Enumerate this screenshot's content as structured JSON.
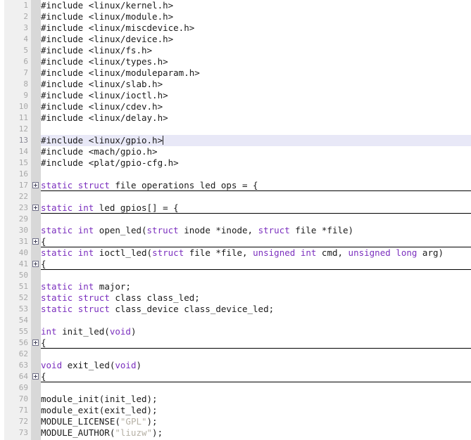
{
  "editor": {
    "type": "source-code-editor",
    "language": "C",
    "gutter_bg": "#f0f0f0",
    "fold_margin_bg": "#d8d8d8",
    "current_line_bg": "#e8e8f7",
    "keyword_color": "#7b2fbe",
    "string_color": "#b5b0a4",
    "text_color": "#1a1a1a",
    "line_number_color": "#a8a8a8",
    "current_line_number": "13",
    "first_visible_line": "1",
    "last_visible_line": "73"
  },
  "lines": [
    {
      "num": "1",
      "folded": false,
      "current": false,
      "tokens": [
        {
          "t": "#include <linux/kernel.h>",
          "c": "pp"
        }
      ]
    },
    {
      "num": "2",
      "folded": false,
      "current": false,
      "tokens": [
        {
          "t": "#include <linux/module.h>",
          "c": "pp"
        }
      ]
    },
    {
      "num": "3",
      "folded": false,
      "current": false,
      "tokens": [
        {
          "t": "#include <linux/miscdevice.h>",
          "c": "pp"
        }
      ]
    },
    {
      "num": "4",
      "folded": false,
      "current": false,
      "tokens": [
        {
          "t": "#include <linux/device.h>",
          "c": "pp"
        }
      ]
    },
    {
      "num": "5",
      "folded": false,
      "current": false,
      "tokens": [
        {
          "t": "#include <linux/fs.h>",
          "c": "pp"
        }
      ]
    },
    {
      "num": "6",
      "folded": false,
      "current": false,
      "tokens": [
        {
          "t": "#include <linux/types.h>",
          "c": "pp"
        }
      ]
    },
    {
      "num": "7",
      "folded": false,
      "current": false,
      "tokens": [
        {
          "t": "#include <linux/moduleparam.h>",
          "c": "pp"
        }
      ]
    },
    {
      "num": "8",
      "folded": false,
      "current": false,
      "tokens": [
        {
          "t": "#include <linux/slab.h>",
          "c": "pp"
        }
      ]
    },
    {
      "num": "9",
      "folded": false,
      "current": false,
      "tokens": [
        {
          "t": "#include <linux/ioctl.h>",
          "c": "pp"
        }
      ]
    },
    {
      "num": "10",
      "folded": false,
      "current": false,
      "tokens": [
        {
          "t": "#include <linux/cdev.h>",
          "c": "pp"
        }
      ]
    },
    {
      "num": "11",
      "folded": false,
      "current": false,
      "tokens": [
        {
          "t": "#include <linux/delay.h>",
          "c": "pp"
        }
      ]
    },
    {
      "num": "12",
      "folded": false,
      "current": false,
      "tokens": []
    },
    {
      "num": "13",
      "folded": false,
      "current": true,
      "caret": true,
      "tokens": [
        {
          "t": "#include <linux/gpio.h>",
          "c": "pp"
        }
      ]
    },
    {
      "num": "14",
      "folded": false,
      "current": false,
      "tokens": [
        {
          "t": "#include <mach/gpio.h>",
          "c": "pp"
        }
      ]
    },
    {
      "num": "15",
      "folded": false,
      "current": false,
      "tokens": [
        {
          "t": "#include <plat/gpio-cfg.h>",
          "c": "pp"
        }
      ]
    },
    {
      "num": "16",
      "folded": false,
      "current": false,
      "tokens": []
    },
    {
      "num": "17",
      "folded": true,
      "current": false,
      "tokens": [
        {
          "t": "static",
          "c": "kw"
        },
        {
          "t": " ",
          "c": "pl"
        },
        {
          "t": "struct",
          "c": "kw"
        },
        {
          "t": " file operations led ops = {",
          "c": "pl"
        }
      ]
    },
    {
      "num": "22",
      "folded": false,
      "current": false,
      "tokens": []
    },
    {
      "num": "23",
      "folded": true,
      "current": false,
      "tokens": [
        {
          "t": "static",
          "c": "kw"
        },
        {
          "t": " ",
          "c": "pl"
        },
        {
          "t": "int",
          "c": "kw"
        },
        {
          "t": " led gpios[] = {",
          "c": "pl"
        }
      ]
    },
    {
      "num": "29",
      "folded": false,
      "current": false,
      "tokens": []
    },
    {
      "num": "30",
      "folded": false,
      "current": false,
      "tokens": [
        {
          "t": "static",
          "c": "kw"
        },
        {
          "t": " ",
          "c": "pl"
        },
        {
          "t": "int",
          "c": "kw"
        },
        {
          "t": " open_led(",
          "c": "pl"
        },
        {
          "t": "struct",
          "c": "kw"
        },
        {
          "t": " inode *inode, ",
          "c": "pl"
        },
        {
          "t": "struct",
          "c": "kw"
        },
        {
          "t": " file *file)",
          "c": "pl"
        }
      ]
    },
    {
      "num": "31",
      "folded": true,
      "current": false,
      "tokens": [
        {
          "t": "{",
          "c": "pl"
        }
      ]
    },
    {
      "num": "40",
      "folded": false,
      "current": false,
      "tokens": [
        {
          "t": "static",
          "c": "kw"
        },
        {
          "t": " ",
          "c": "pl"
        },
        {
          "t": "int",
          "c": "kw"
        },
        {
          "t": " ioctl_led(",
          "c": "pl"
        },
        {
          "t": "struct",
          "c": "kw"
        },
        {
          "t": " file *file, ",
          "c": "pl"
        },
        {
          "t": "unsigned",
          "c": "kw"
        },
        {
          "t": " ",
          "c": "pl"
        },
        {
          "t": "int",
          "c": "kw"
        },
        {
          "t": " cmd, ",
          "c": "pl"
        },
        {
          "t": "unsigned",
          "c": "kw"
        },
        {
          "t": " ",
          "c": "pl"
        },
        {
          "t": "long",
          "c": "kw"
        },
        {
          "t": " arg)",
          "c": "pl"
        }
      ]
    },
    {
      "num": "41",
      "folded": true,
      "current": false,
      "tokens": [
        {
          "t": "{",
          "c": "pl"
        }
      ]
    },
    {
      "num": "50",
      "folded": false,
      "current": false,
      "tokens": []
    },
    {
      "num": "51",
      "folded": false,
      "current": false,
      "tokens": [
        {
          "t": "static",
          "c": "kw"
        },
        {
          "t": " ",
          "c": "pl"
        },
        {
          "t": "int",
          "c": "kw"
        },
        {
          "t": " major;",
          "c": "pl"
        }
      ]
    },
    {
      "num": "52",
      "folded": false,
      "current": false,
      "tokens": [
        {
          "t": "static",
          "c": "kw"
        },
        {
          "t": " ",
          "c": "pl"
        },
        {
          "t": "struct",
          "c": "kw"
        },
        {
          "t": " class class_led;",
          "c": "pl"
        }
      ]
    },
    {
      "num": "53",
      "folded": false,
      "current": false,
      "tokens": [
        {
          "t": "static",
          "c": "kw"
        },
        {
          "t": " ",
          "c": "pl"
        },
        {
          "t": "struct",
          "c": "kw"
        },
        {
          "t": " class_device class_device_led;",
          "c": "pl"
        }
      ]
    },
    {
      "num": "54",
      "folded": false,
      "current": false,
      "tokens": []
    },
    {
      "num": "55",
      "folded": false,
      "current": false,
      "tokens": [
        {
          "t": "int",
          "c": "kw"
        },
        {
          "t": " init_led(",
          "c": "pl"
        },
        {
          "t": "void",
          "c": "kw"
        },
        {
          "t": ")",
          "c": "pl"
        }
      ]
    },
    {
      "num": "56",
      "folded": true,
      "current": false,
      "tokens": [
        {
          "t": "{",
          "c": "pl"
        }
      ]
    },
    {
      "num": "62",
      "folded": false,
      "current": false,
      "tokens": []
    },
    {
      "num": "63",
      "folded": false,
      "current": false,
      "tokens": [
        {
          "t": "void",
          "c": "kw"
        },
        {
          "t": " exit_led(",
          "c": "pl"
        },
        {
          "t": "void",
          "c": "kw"
        },
        {
          "t": ")",
          "c": "pl"
        }
      ]
    },
    {
      "num": "64",
      "folded": true,
      "current": false,
      "tokens": [
        {
          "t": "{",
          "c": "pl"
        }
      ]
    },
    {
      "num": "69",
      "folded": false,
      "current": false,
      "tokens": []
    },
    {
      "num": "70",
      "folded": false,
      "current": false,
      "tokens": [
        {
          "t": "module_init(init_led);",
          "c": "pl"
        }
      ]
    },
    {
      "num": "71",
      "folded": false,
      "current": false,
      "tokens": [
        {
          "t": "module_exit(exit_led);",
          "c": "pl"
        }
      ]
    },
    {
      "num": "72",
      "folded": false,
      "current": false,
      "tokens": [
        {
          "t": "MODULE_LICENSE(",
          "c": "pl"
        },
        {
          "t": "\"GPL\"",
          "c": "str"
        },
        {
          "t": ");",
          "c": "pl"
        }
      ]
    },
    {
      "num": "73",
      "folded": false,
      "current": false,
      "tokens": [
        {
          "t": "MODULE_AUTHOR(",
          "c": "pl"
        },
        {
          "t": "\"liuzw\"",
          "c": "str"
        },
        {
          "t": ");",
          "c": "pl"
        }
      ]
    }
  ]
}
